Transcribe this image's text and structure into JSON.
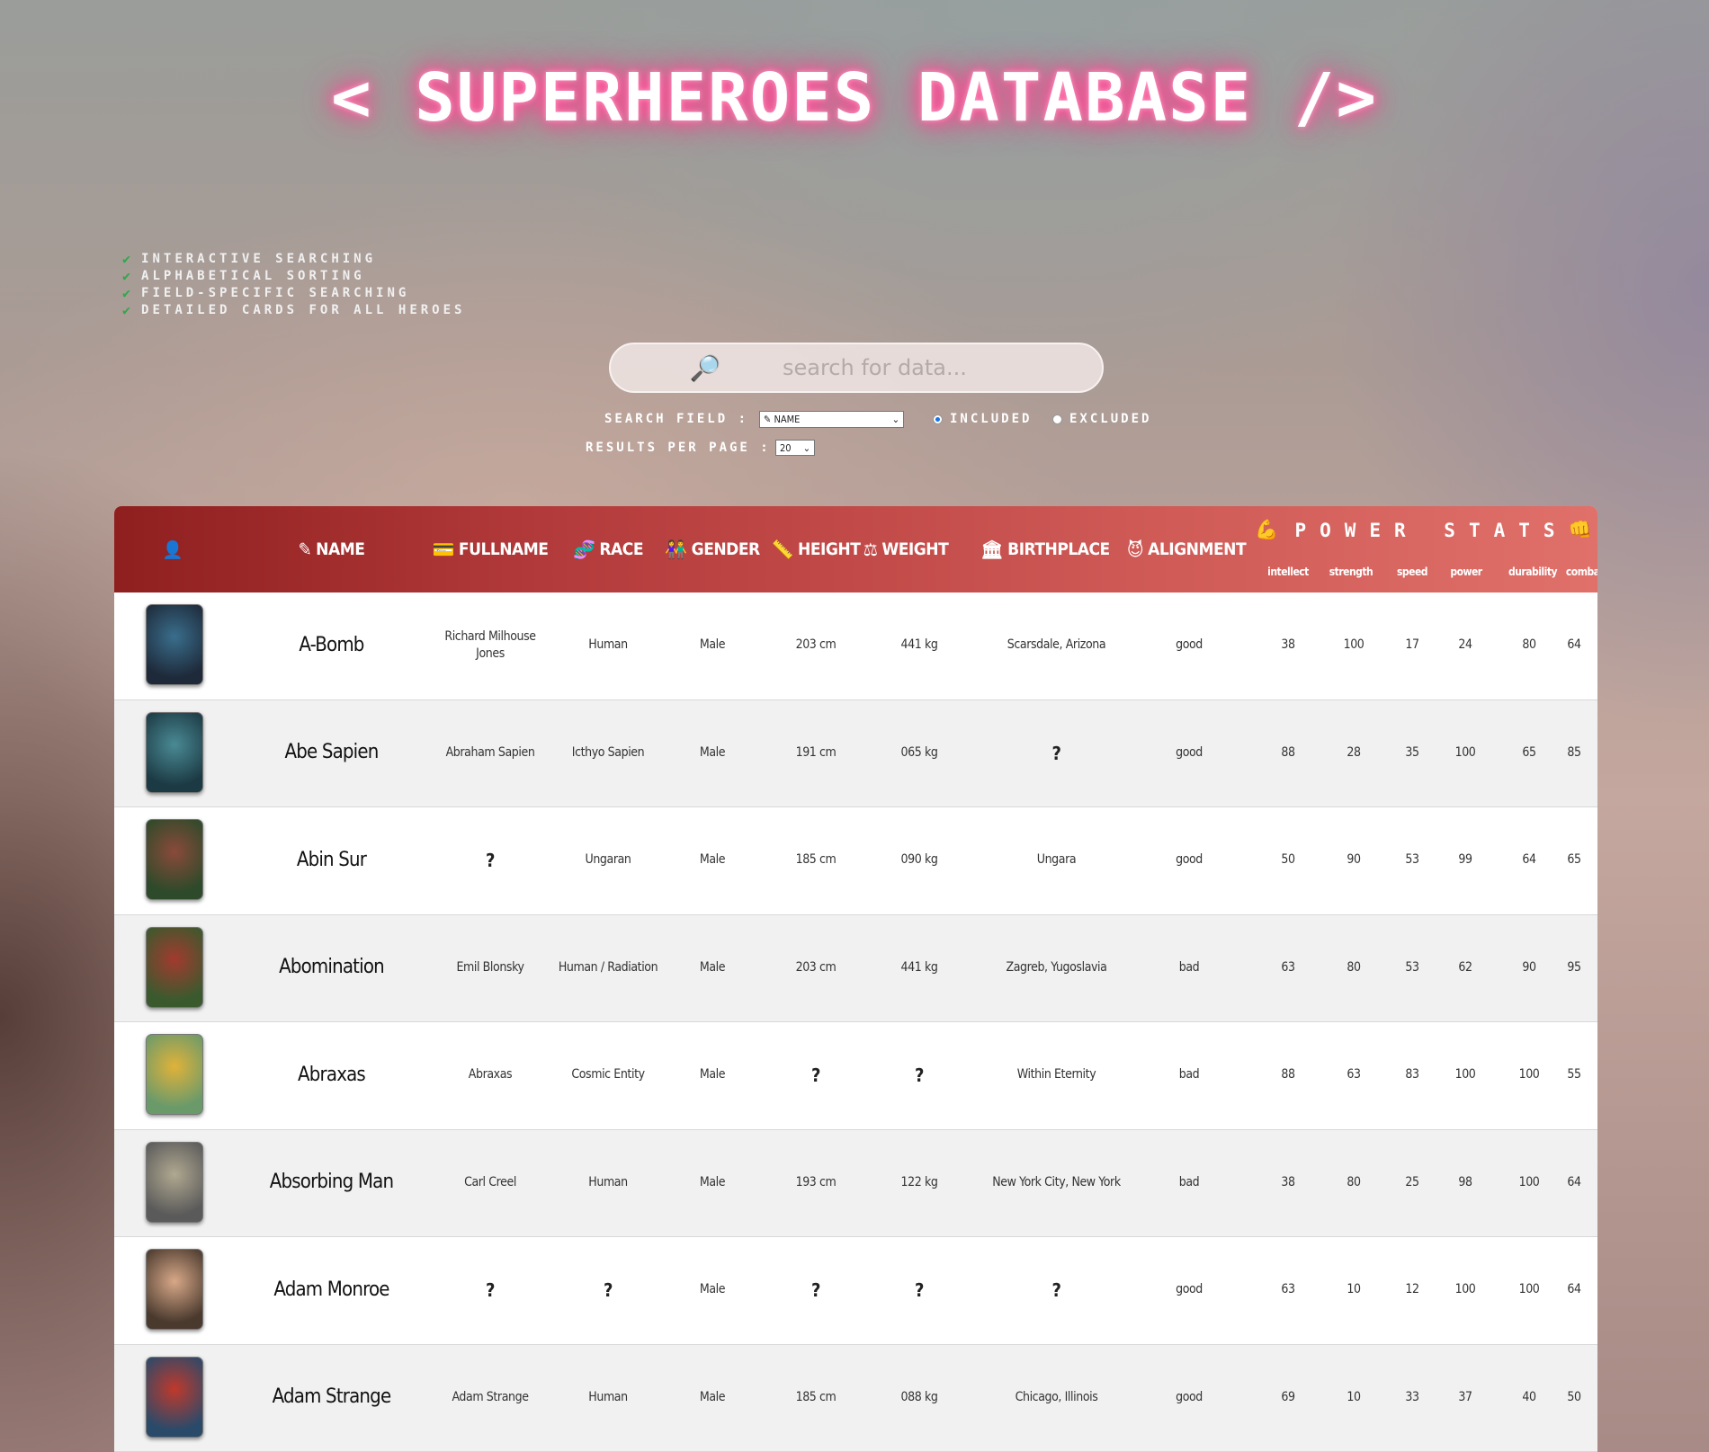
{
  "title": "< SUPERHEROES DATABASE />",
  "features": [
    "INTERACTIVE SEARCHING",
    "ALPHABETICAL SORTING",
    "FIELD-SPECIFIC SEARCHING",
    "DETAILED CARDS FOR ALL HEROES"
  ],
  "search": {
    "placeholder": "search for data..."
  },
  "controls": {
    "search_field_label": "SEARCH FIELD :",
    "search_field_value": "NAME",
    "included_label": "INCLUDED",
    "excluded_label": "EXCLUDED",
    "results_label": "RESULTS PER PAGE :",
    "results_value": "20"
  },
  "table": {
    "headers": [
      "NAME",
      "FULLNAME",
      "RACE",
      "GENDER",
      "HEIGHT",
      "WEIGHT",
      "BIRTHPLACE",
      "ALIGNMENT"
    ],
    "power_stats_title": "POWER STATS",
    "stat_headers": [
      "intellect",
      "strength",
      "speed",
      "power",
      "durability",
      "combat"
    ],
    "rows": [
      {
        "name": "A-Bomb",
        "fullname": "Richard Milhouse Jones",
        "race": "Human",
        "gender": "Male",
        "height": "203 cm",
        "weight": "441 kg",
        "birthplace": "Scarsdale, Arizona",
        "alignment": "good",
        "stats": [
          "38",
          "100",
          "17",
          "24",
          "80",
          "64"
        ],
        "colors": [
          "#1e2a3a",
          "#3a6e8c"
        ]
      },
      {
        "name": "Abe Sapien",
        "fullname": "Abraham Sapien",
        "race": "Icthyo Sapien",
        "gender": "Male",
        "height": "191 cm",
        "weight": "065 kg",
        "birthplace": "?",
        "alignment": "good",
        "stats": [
          "88",
          "28",
          "35",
          "100",
          "65",
          "85"
        ],
        "colors": [
          "#1c3a44",
          "#4a8a94"
        ]
      },
      {
        "name": "Abin Sur",
        "fullname": "?",
        "race": "Ungaran",
        "gender": "Male",
        "height": "185 cm",
        "weight": "090 kg",
        "birthplace": "Ungara",
        "alignment": "good",
        "stats": [
          "50",
          "90",
          "53",
          "99",
          "64",
          "65"
        ],
        "colors": [
          "#2d4a2a",
          "#8a4a3a"
        ]
      },
      {
        "name": "Abomination",
        "fullname": "Emil Blonsky",
        "race": "Human / Radiation",
        "gender": "Male",
        "height": "203 cm",
        "weight": "441 kg",
        "birthplace": "Zagreb, Yugoslavia",
        "alignment": "bad",
        "stats": [
          "63",
          "80",
          "53",
          "62",
          "90",
          "95"
        ],
        "colors": [
          "#3a5a2e",
          "#a23a2e"
        ]
      },
      {
        "name": "Abraxas",
        "fullname": "Abraxas",
        "race": "Cosmic Entity",
        "gender": "Male",
        "height": "?",
        "weight": "?",
        "birthplace": "Within Eternity",
        "alignment": "bad",
        "stats": [
          "88",
          "63",
          "83",
          "100",
          "100",
          "55"
        ],
        "colors": [
          "#6a9a6a",
          "#e0b23a"
        ]
      },
      {
        "name": "Absorbing Man",
        "fullname": "Carl Creel",
        "race": "Human",
        "gender": "Male",
        "height": "193 cm",
        "weight": "122 kg",
        "birthplace": "New York City, New York",
        "alignment": "bad",
        "stats": [
          "38",
          "80",
          "25",
          "98",
          "100",
          "64"
        ],
        "colors": [
          "#5a5a5a",
          "#b0a890"
        ]
      },
      {
        "name": "Adam Monroe",
        "fullname": "?",
        "race": "?",
        "gender": "Male",
        "height": "?",
        "weight": "?",
        "birthplace": "?",
        "alignment": "good",
        "stats": [
          "63",
          "10",
          "12",
          "100",
          "100",
          "64"
        ],
        "colors": [
          "#4a3a2e",
          "#d8a888"
        ]
      },
      {
        "name": "Adam Strange",
        "fullname": "Adam Strange",
        "race": "Human",
        "gender": "Male",
        "height": "185 cm",
        "weight": "088 kg",
        "birthplace": "Chicago, Illinois",
        "alignment": "good",
        "stats": [
          "69",
          "10",
          "33",
          "37",
          "40",
          "50"
        ],
        "colors": [
          "#2a4a6a",
          "#c0392b"
        ]
      }
    ]
  }
}
